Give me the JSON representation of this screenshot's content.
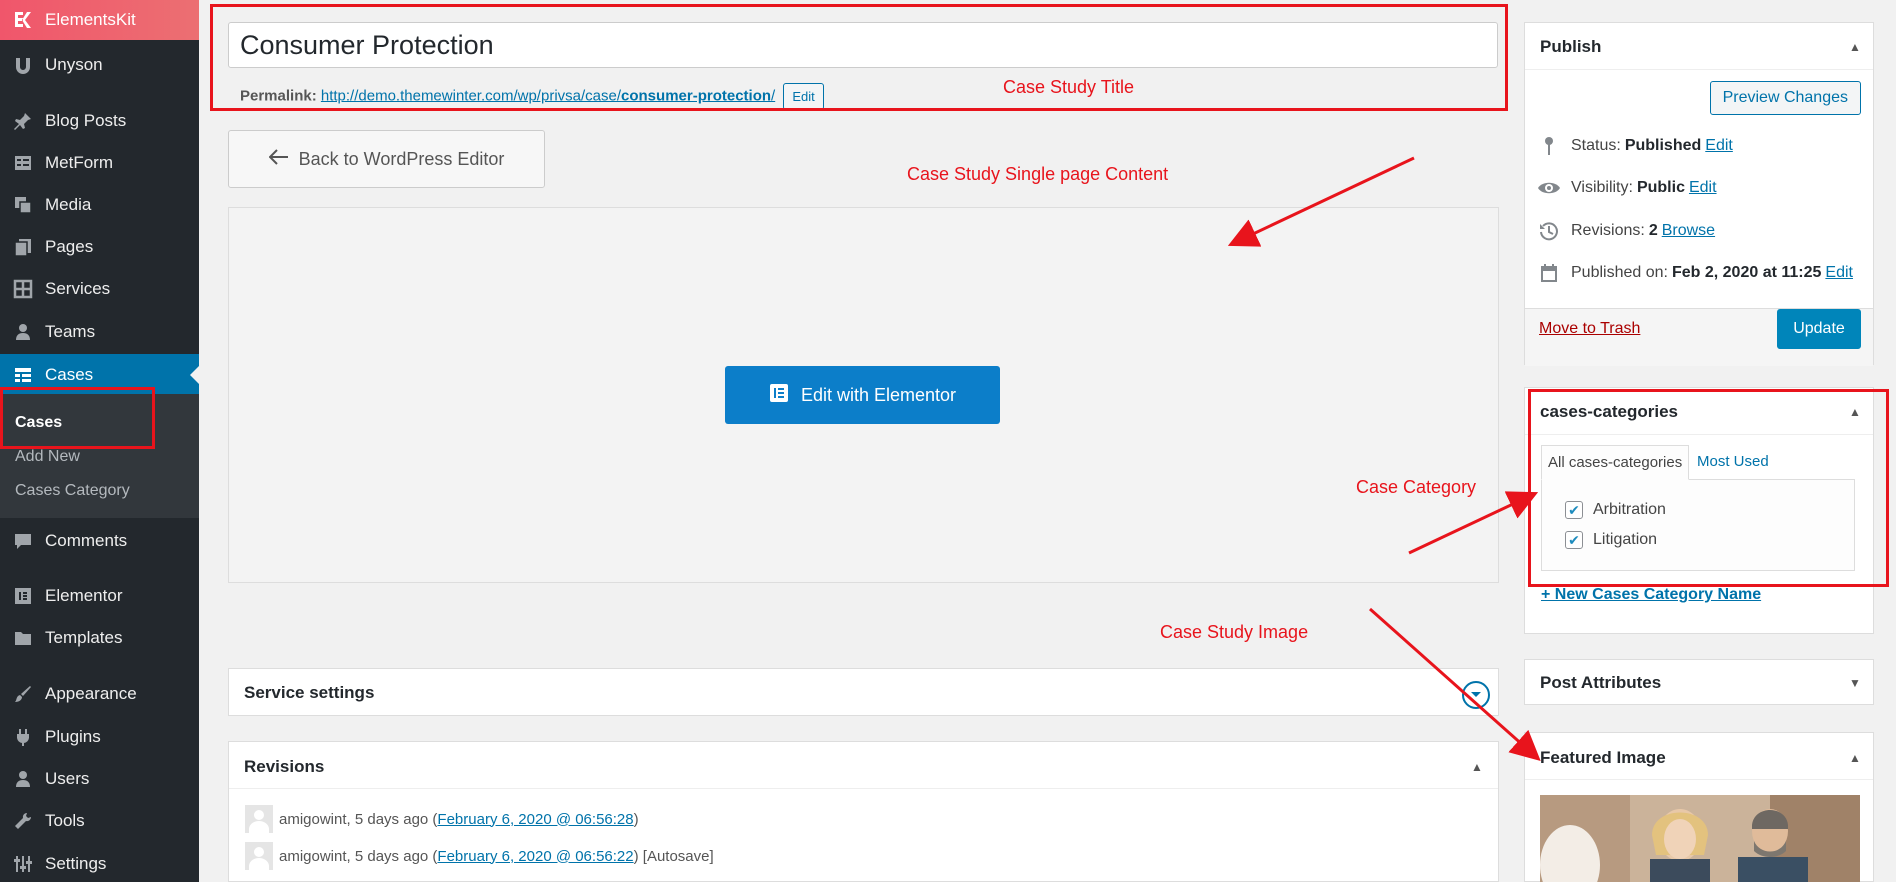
{
  "sidebar": {
    "items": [
      {
        "label": "ElementsKit",
        "icon": "elementskit-icon"
      },
      {
        "label": "Unyson",
        "icon": "unyson-icon"
      },
      {
        "label": "Blog Posts",
        "icon": "pin-icon"
      },
      {
        "label": "MetForm",
        "icon": "form-icon"
      },
      {
        "label": "Media",
        "icon": "media-icon"
      },
      {
        "label": "Pages",
        "icon": "pages-icon"
      },
      {
        "label": "Services",
        "icon": "grid-icon"
      },
      {
        "label": "Teams",
        "icon": "person-icon"
      },
      {
        "label": "Cases",
        "icon": "table-icon"
      },
      {
        "label": "Comments",
        "icon": "comment-icon"
      },
      {
        "label": "Elementor",
        "icon": "elementor-icon"
      },
      {
        "label": "Templates",
        "icon": "folder-icon"
      },
      {
        "label": "Appearance",
        "icon": "brush-icon"
      },
      {
        "label": "Plugins",
        "icon": "plugin-icon"
      },
      {
        "label": "Users",
        "icon": "user-icon"
      },
      {
        "label": "Tools",
        "icon": "wrench-icon"
      },
      {
        "label": "Settings",
        "icon": "settings-icon"
      }
    ],
    "submenu": [
      "Cases",
      "Add New",
      "Cases Category"
    ]
  },
  "editor": {
    "title": "Consumer Protection",
    "permalink_label": "Permalink:",
    "permalink_base": "http://demo.themewinter.com/wp/privsa/case/",
    "permalink_slug": "consumer-protection",
    "permalink_end": "/",
    "permalink_edit": "Edit",
    "back_button": "Back to WordPress Editor",
    "elementor_button": "Edit with Elementor"
  },
  "annotations": {
    "title": "Case Study Title",
    "content": "Case Study Single page Content",
    "category": "Case Category",
    "image": "Case Study Image"
  },
  "service_settings": {
    "title": "Service settings"
  },
  "revisions": {
    "title": "Revisions",
    "items": [
      {
        "prefix": "amigowint, 5 days ago (",
        "link": "February 6, 2020 @ 06:56:28",
        "suffix": ")"
      },
      {
        "prefix": "amigowint, 5 days ago (",
        "link": "February 6, 2020 @ 06:56:22",
        "suffix": ") [Autosave]"
      }
    ]
  },
  "publish": {
    "title": "Publish",
    "preview": "Preview Changes",
    "status_label": "Status:",
    "status_value": "Published",
    "visibility_label": "Visibility:",
    "visibility_value": "Public",
    "revisions_label": "Revisions:",
    "revisions_value": "2",
    "browse": "Browse",
    "published_label": "Published on:",
    "published_value": "Feb 2, 2020 at 11:25",
    "edit": "Edit",
    "trash": "Move to Trash",
    "update": "Update"
  },
  "categories": {
    "title": "cases-categories",
    "tab_all": "All cases-categories",
    "tab_used": "Most Used",
    "items": [
      "Arbitration",
      "Litigation"
    ],
    "new_link": "+ New Cases Category Name"
  },
  "attributes": {
    "title": "Post Attributes"
  },
  "featured": {
    "title": "Featured Image"
  },
  "colors": {
    "accent": "#0073aa",
    "annotation": "#e8141c",
    "sidebar": "#23282d"
  }
}
